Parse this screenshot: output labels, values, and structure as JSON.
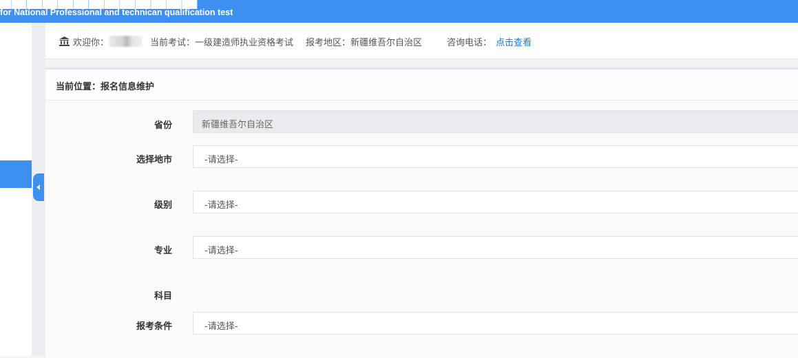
{
  "header": {
    "subtitle": "for National Professional and technican qualification test"
  },
  "info_bar": {
    "welcome_label": "欢迎你：",
    "exam_label": "当前考试：一级建造师执业资格考试",
    "region_label": "报考地区：新疆维吾尔自治区",
    "phone_label": "咨询电话：",
    "phone_link": "点击查看"
  },
  "breadcrumb": "当前位置：报名信息维护",
  "form": {
    "province": {
      "label": "省份",
      "value": "新疆维吾尔自治区"
    },
    "city": {
      "label": "选择地市",
      "value": "-请选择-"
    },
    "level": {
      "label": "级别",
      "value": "-请选择-"
    },
    "major": {
      "label": "专业",
      "value": "-请选择-"
    },
    "subject": {
      "label": "科目"
    },
    "condition": {
      "label": "报考条件",
      "value": "-请选择-"
    }
  },
  "colors": {
    "primary": "#3d8ff0",
    "link": "#1e7bd6",
    "readonly_bg": "#e9ebee"
  }
}
